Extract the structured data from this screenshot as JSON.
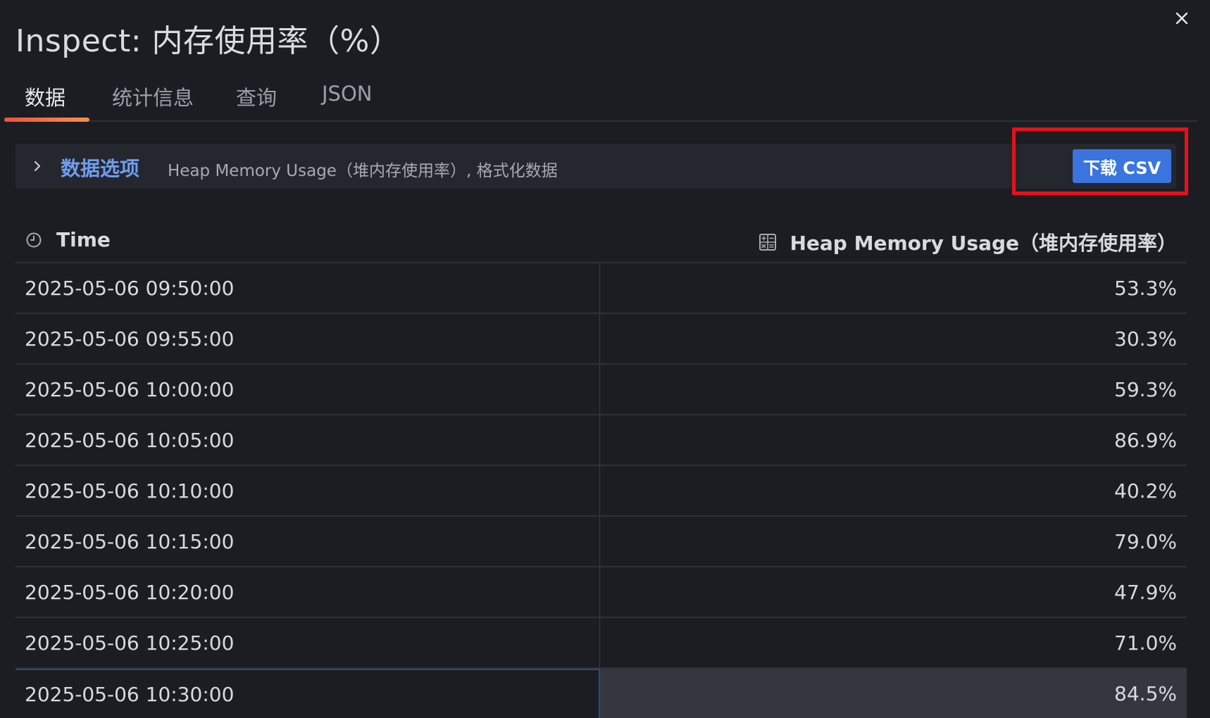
{
  "title": "Inspect: 内存使用率（%）",
  "tabs": [
    {
      "label": "数据",
      "active": true
    },
    {
      "label": "统计信息",
      "active": false
    },
    {
      "label": "查询",
      "active": false
    },
    {
      "label": "JSON",
      "active": false
    }
  ],
  "options": {
    "label": "数据选项",
    "description": "Heap Memory Usage（堆内存使用率）, 格式化数据"
  },
  "download_button": "下载 CSV",
  "table": {
    "columns": [
      "Time",
      "Heap Memory Usage（堆内存使用率）"
    ],
    "rows": [
      {
        "time": "2025-05-06 09:50:00",
        "value": "53.3%"
      },
      {
        "time": "2025-05-06 09:55:00",
        "value": "30.3%"
      },
      {
        "time": "2025-05-06 10:00:00",
        "value": "59.3%"
      },
      {
        "time": "2025-05-06 10:05:00",
        "value": "86.9%"
      },
      {
        "time": "2025-05-06 10:10:00",
        "value": "40.2%"
      },
      {
        "time": "2025-05-06 10:15:00",
        "value": "79.0%"
      },
      {
        "time": "2025-05-06 10:20:00",
        "value": "47.9%"
      },
      {
        "time": "2025-05-06 10:25:00",
        "value": "71.0%"
      },
      {
        "time": "2025-05-06 10:30:00",
        "value": "84.5%"
      }
    ]
  },
  "icons": {
    "close": "close-icon",
    "chevron": "chevron-right-icon",
    "clock": "clock-icon",
    "calculator": "calculator-icon"
  },
  "colors": {
    "background": "#1c1d22",
    "accent_blue": "#3a74de",
    "link_blue": "#6f9ef0",
    "tab_active_gradient": [
      "#f0533a",
      "#f5914e"
    ],
    "highlight_red": "#e8101a"
  }
}
